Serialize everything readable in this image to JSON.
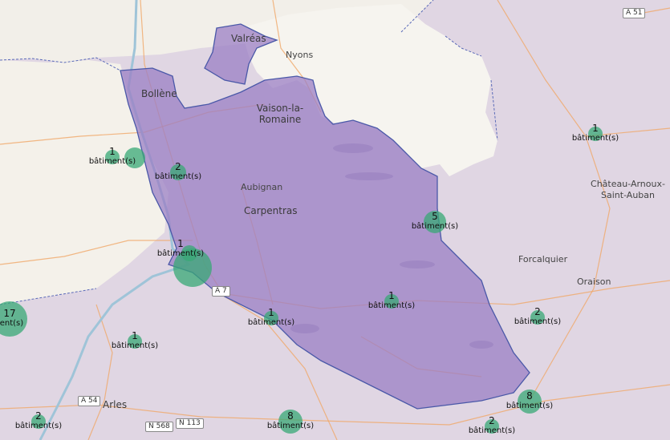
{
  "map": {
    "cities": [
      {
        "id": "valreas",
        "name": "Valréas"
      },
      {
        "id": "nyons",
        "name": "Nyons"
      },
      {
        "id": "bollene",
        "name": "Bollène"
      },
      {
        "id": "vaison",
        "name": "Vaison-la-Romaine"
      },
      {
        "id": "aubignan",
        "name": "Aubignan"
      },
      {
        "id": "carpentras",
        "name": "Carpentras"
      },
      {
        "id": "chateau",
        "name": "Château-Arnoux-Saint-Auban"
      },
      {
        "id": "forcalquier",
        "name": "Forcalquier"
      },
      {
        "id": "oraison",
        "name": "Oraison"
      },
      {
        "id": "arles",
        "name": "Arles"
      }
    ],
    "roads": [
      {
        "id": "a51",
        "name": "A 51"
      },
      {
        "id": "a7",
        "name": "A 7"
      },
      {
        "id": "a54",
        "name": "A 54"
      },
      {
        "id": "n568",
        "name": "N 568"
      },
      {
        "id": "n113",
        "name": "N 113"
      }
    ],
    "unit_label": "bâtiment(s)",
    "clusters": [
      {
        "id": "c1",
        "count": "1"
      },
      {
        "id": "c2",
        "count": "2"
      },
      {
        "id": "c3",
        "count": "1"
      },
      {
        "id": "c4",
        "count": "5"
      },
      {
        "id": "c5",
        "count": "1"
      },
      {
        "id": "c6",
        "count": "1"
      },
      {
        "id": "c7",
        "count": "1"
      },
      {
        "id": "c8",
        "count": "2"
      },
      {
        "id": "c9",
        "count": "17"
      },
      {
        "id": "c10",
        "count": "1"
      },
      {
        "id": "c11",
        "count": "8"
      },
      {
        "id": "c12",
        "count": "8"
      },
      {
        "id": "c13",
        "count": "2"
      },
      {
        "id": "c14",
        "count": "2"
      }
    ],
    "colors": {
      "background": "#f2efe9",
      "region_fill": "#9b7fc4",
      "region_stroke": "#4a58a8",
      "cluster": "#38a876",
      "road": "#f0a868"
    }
  }
}
